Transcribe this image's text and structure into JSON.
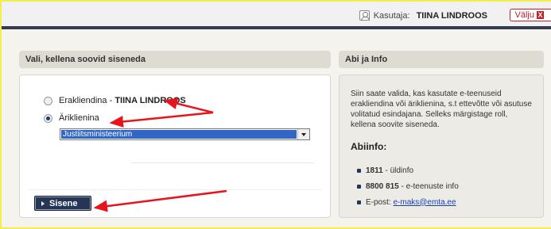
{
  "header": {
    "user_label": "Kasutaja:",
    "user_name": "TIINA LINDROOS",
    "logout_label": "Välju",
    "logout_icon_glyph": "X"
  },
  "main_panel": {
    "title": "Vali, kellena soovid siseneda",
    "options": [
      {
        "label": "Erakliendina - ",
        "name": "TIINA LINDROOS",
        "checked": false
      },
      {
        "label": "Äriklienina",
        "name": "",
        "checked": true
      }
    ],
    "select_value": "Justiitsministeerium",
    "submit_label": "Sisene"
  },
  "info_panel": {
    "title": "Abi ja Info",
    "text": "Siin saate valida, kas kasutate e-teenuseid erakliendina või äriklienina, s.t ettevõtte või asutuse volitatud esindajana. Selleks märgistage roll, kellena soovite siseneda.",
    "help_title": "Abiinfo:",
    "items": [
      {
        "bold": "1811",
        "text": " - üldinfo"
      },
      {
        "bold": "8800 815",
        "text": " - e-teenuste info"
      },
      {
        "prefix": "E-post: ",
        "link": "e-maks@emta.ee"
      }
    ]
  },
  "colors": {
    "accent": "#253556",
    "annotation": "#e8141c",
    "select_highlight": "#3166c9",
    "frame": "#f3ee4a"
  }
}
